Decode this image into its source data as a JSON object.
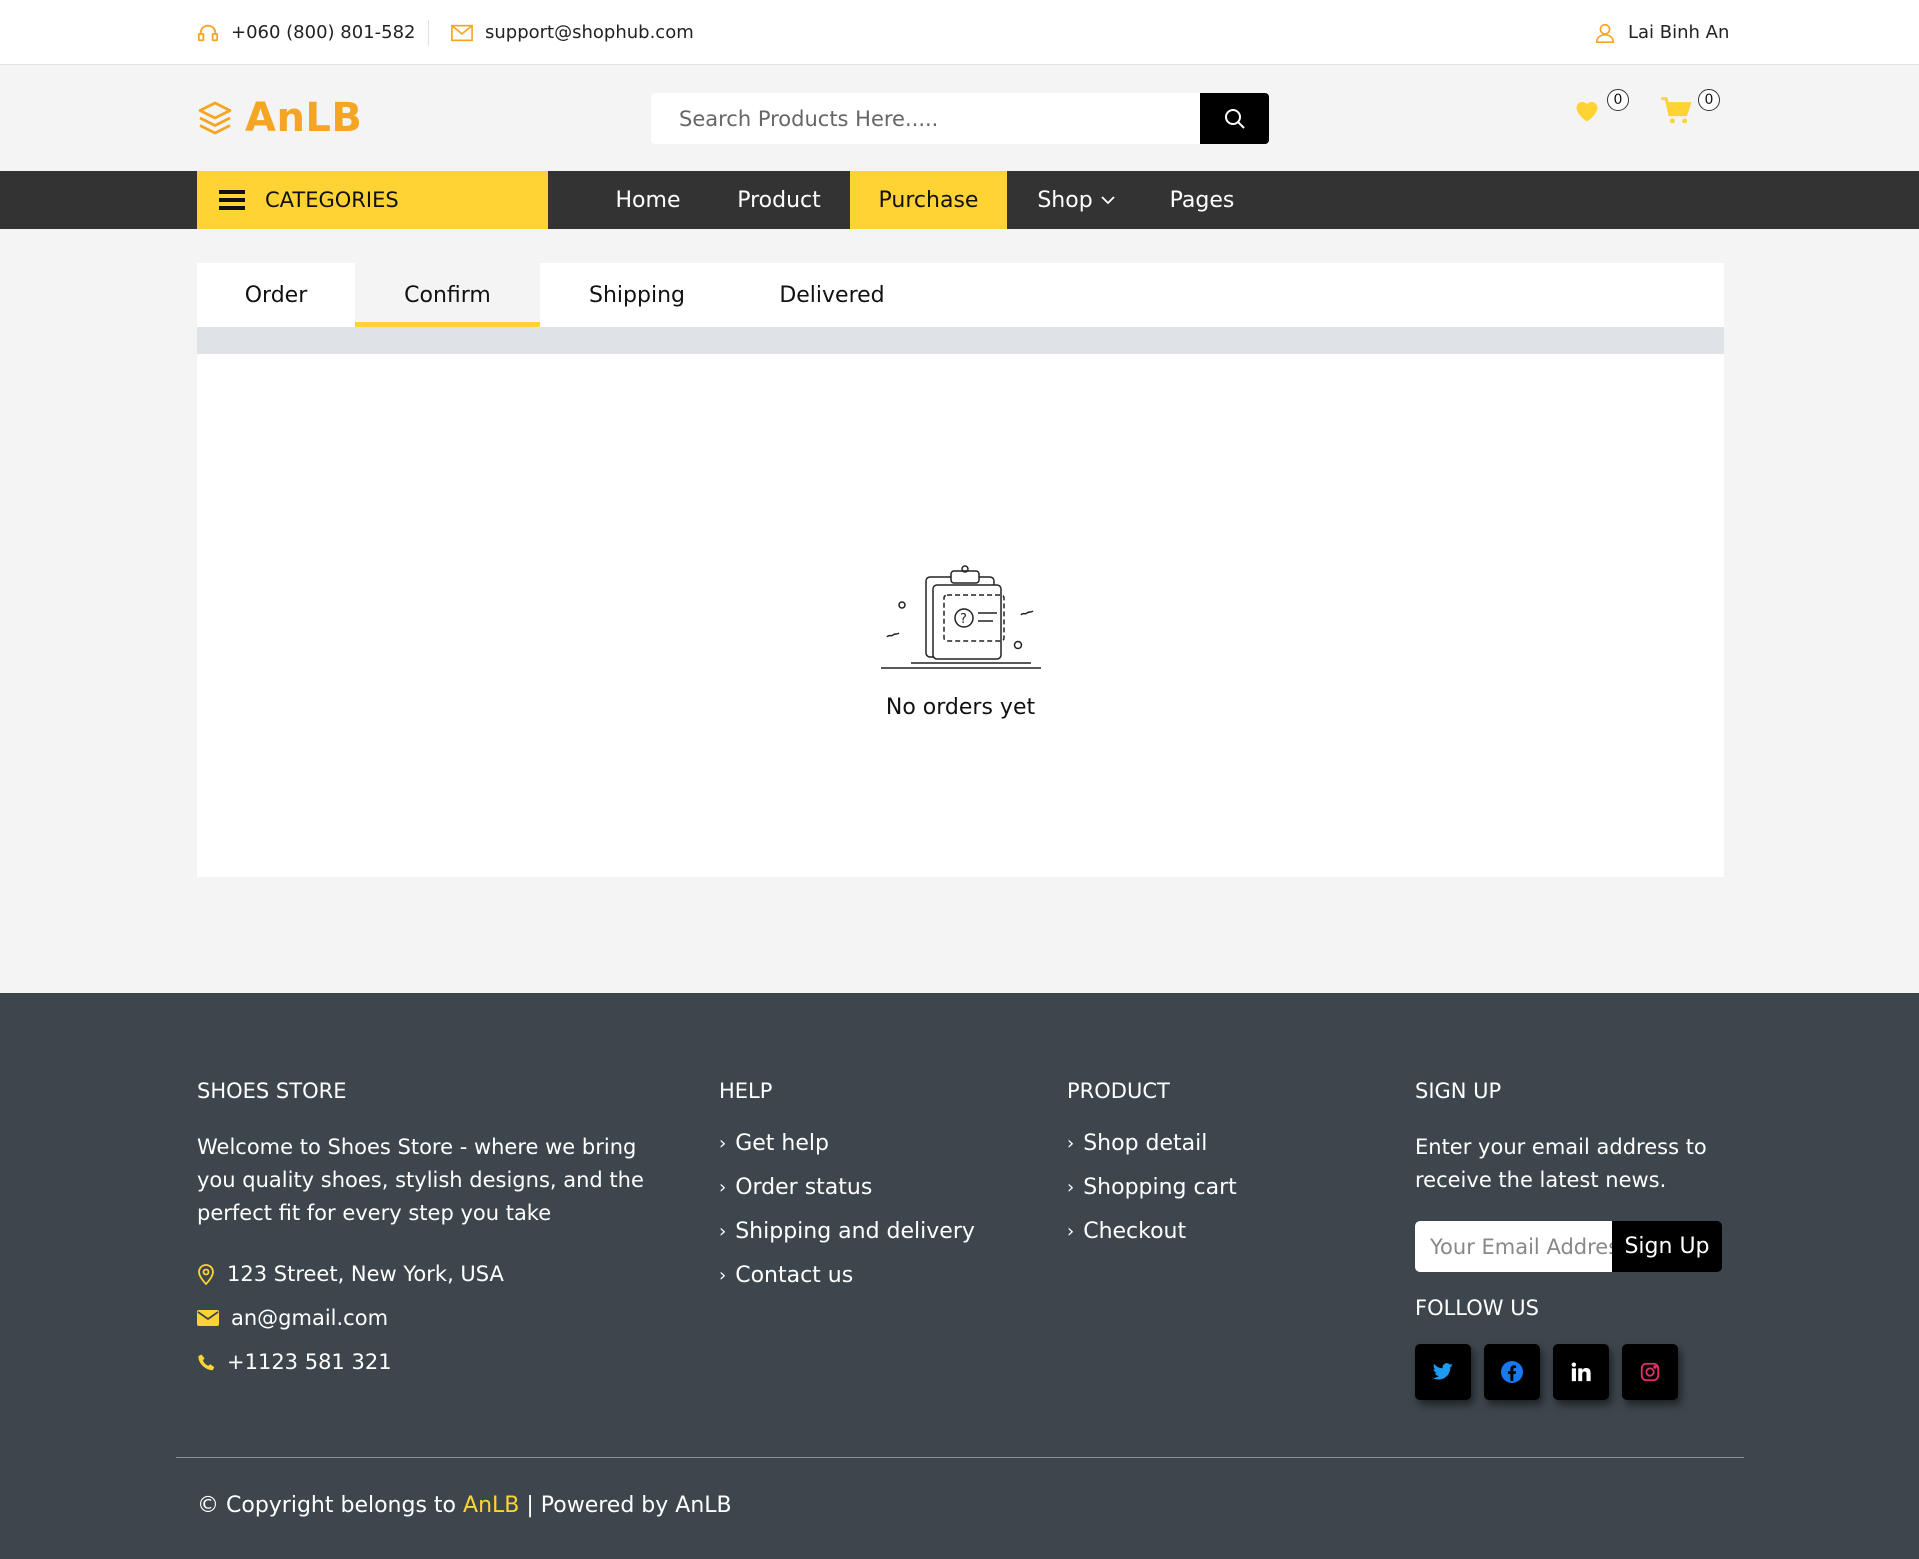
{
  "topbar": {
    "phone": "+060 (800) 801-582",
    "email": "support@shophub.com",
    "user": "Lai Binh An"
  },
  "header": {
    "logo": "AnLB",
    "search_placeholder": "Search Products Here.....",
    "wishlist_count": "0",
    "cart_count": "0"
  },
  "nav": {
    "categories_label": "CATEGORIES",
    "links": [
      "Home",
      "Product",
      "Purchase",
      "Shop",
      "Pages"
    ],
    "active": "Purchase"
  },
  "tabs": {
    "items": [
      "Order",
      "Confirm",
      "Shipping",
      "Delivered"
    ],
    "active": "Confirm"
  },
  "empty_state": {
    "message": "No orders yet"
  },
  "footer": {
    "store": {
      "heading": "SHOES STORE",
      "description": "Welcome to Shoes Store - where we bring you quality shoes, stylish designs, and the perfect fit for every step you take",
      "address": "123 Street, New York, USA",
      "email": "an@gmail.com",
      "phone": "+1123 581 321"
    },
    "help": {
      "heading": "HELP",
      "links": [
        "Get help",
        "Order status",
        "Shipping and delivery",
        "Contact us"
      ]
    },
    "product": {
      "heading": "PRODUCT",
      "links": [
        "Shop detail",
        "Shopping cart",
        "Checkout"
      ]
    },
    "signup": {
      "heading": "SIGN UP",
      "text": "Enter your email address to receive the latest news.",
      "placeholder": "Your Email Address",
      "button": "Sign Up",
      "follow_heading": "FOLLOW US",
      "socials": [
        "twitter-icon",
        "facebook-icon",
        "linkedin-icon",
        "instagram-icon"
      ]
    },
    "copyright_prefix": "© Copyright belongs to",
    "copyright_brand": "AnLB",
    "copyright_suffix": "| Powered by AnLB"
  },
  "colors": {
    "accent": "#ffd333",
    "logo": "#f5a524",
    "nav_bg": "#333333",
    "footer_bg": "#3d464d"
  }
}
